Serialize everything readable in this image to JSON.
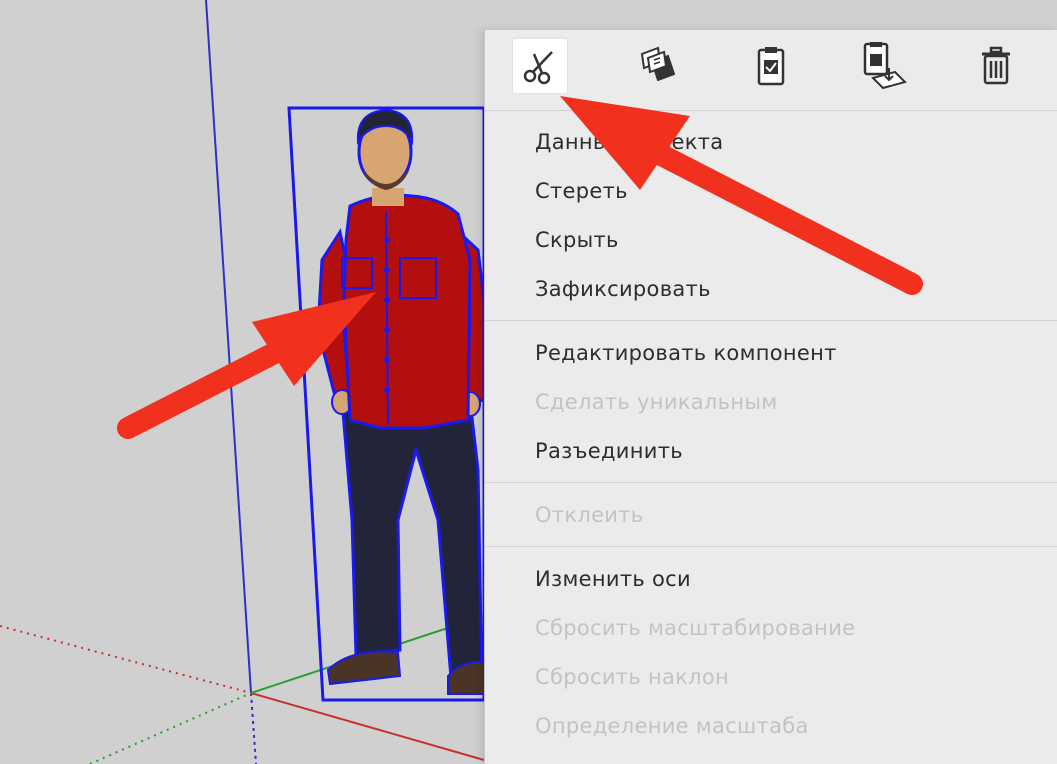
{
  "toolbar": {
    "icons": [
      "scissors-icon",
      "copy-icon",
      "paste-icon",
      "paste-in-place-icon",
      "trash-icon"
    ]
  },
  "menu": {
    "group1": [
      {
        "label": "Данные объекта",
        "enabled": true
      },
      {
        "label": "Стереть",
        "enabled": true
      },
      {
        "label": "Скрыть",
        "enabled": true
      },
      {
        "label": "Зафиксировать",
        "enabled": true
      }
    ],
    "group2": [
      {
        "label": "Редактировать компонент",
        "enabled": true
      },
      {
        "label": "Сделать уникальным",
        "enabled": false
      },
      {
        "label": "Разъединить",
        "enabled": true
      }
    ],
    "group3": [
      {
        "label": "Отклеить",
        "enabled": false
      }
    ],
    "group4": [
      {
        "label": "Изменить оси",
        "enabled": true
      },
      {
        "label": "Сбросить масштабирование",
        "enabled": false
      },
      {
        "label": "Сбросить наклон",
        "enabled": false
      },
      {
        "label": "Определение масштаба",
        "enabled": false
      }
    ]
  },
  "colors": {
    "selection": "#1a1aee",
    "annotation_arrow": "#f2301e",
    "shirt": "#b40f0f",
    "pants": "#22243a"
  }
}
